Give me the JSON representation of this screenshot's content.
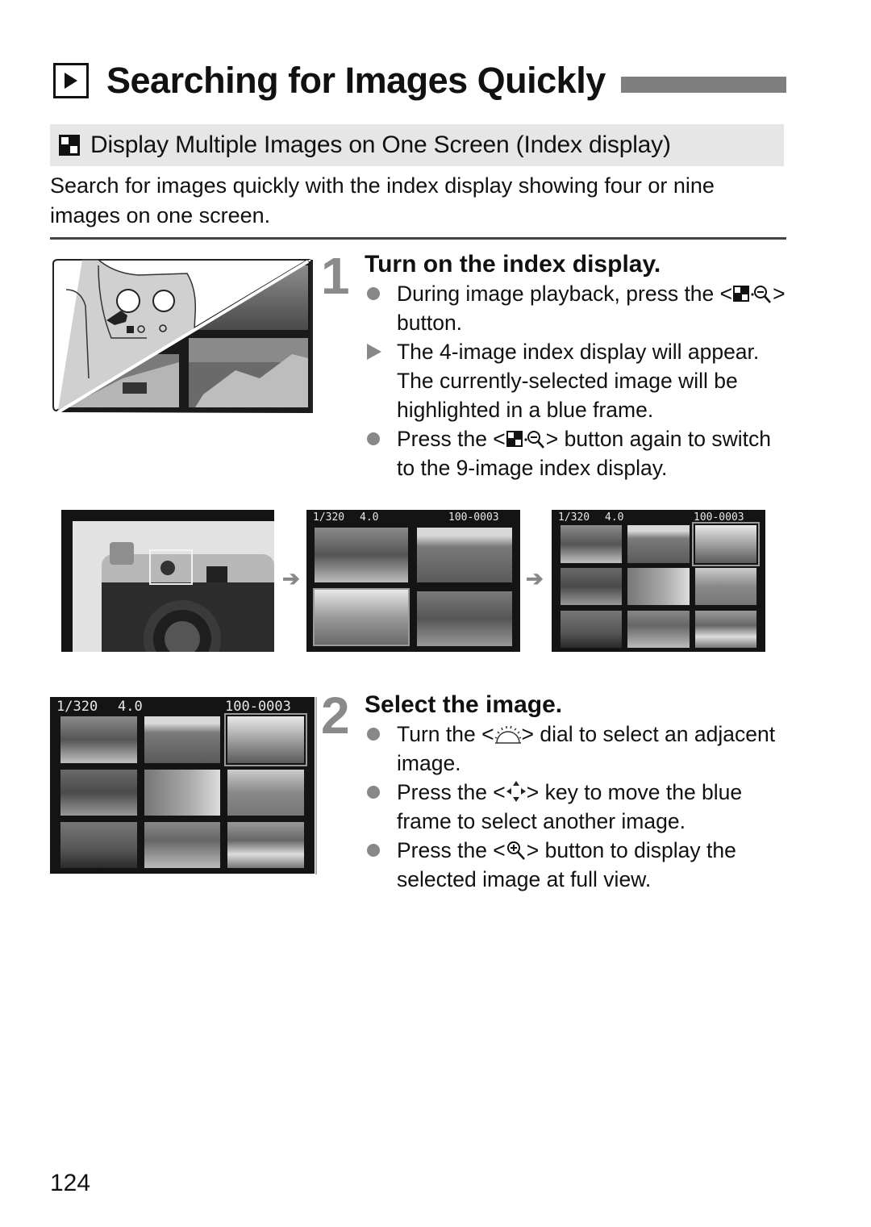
{
  "page": {
    "title": "Searching for Images Quickly",
    "title_icon": "playback-icon",
    "page_number": "124"
  },
  "section": {
    "title": "Display Multiple Images on One Screen (Index display)",
    "icon": "index-display-icon",
    "intro": "Search for images quickly with the index display showing four or nine images on one screen."
  },
  "steps": [
    {
      "number": "1",
      "title": "Turn on the index display.",
      "items": [
        {
          "marker": "bullet",
          "before": "During image playback, press the <",
          "icon": "index-reduce-button-icon",
          "after": "> button."
        },
        {
          "marker": "result",
          "before": "The 4-image index display will appear. The currently-selected image will be highlighted in a blue frame.",
          "icon": "",
          "after": ""
        },
        {
          "marker": "bullet",
          "before": "Press the <",
          "icon": "index-reduce-button-icon",
          "after": "> button again to switch to the 9-image index display."
        }
      ]
    },
    {
      "number": "2",
      "title": "Select the image.",
      "items": [
        {
          "marker": "bullet",
          "before": "Turn the <",
          "icon": "main-dial-icon",
          "after": "> dial to select an adjacent image."
        },
        {
          "marker": "bullet",
          "before": "Press the <",
          "icon": "cross-keys-icon",
          "after": "> key to move the blue frame to select another image."
        },
        {
          "marker": "bullet",
          "before": "Press the <",
          "icon": "magnify-button-icon",
          "after": "> button to display the selected image at full view."
        }
      ]
    }
  ],
  "screens": {
    "osd": {
      "shutter": "1/320",
      "aperture": "4.0",
      "file": "100-0003"
    },
    "four_index": {
      "count": 4,
      "selected_index": 2
    },
    "nine_index": {
      "count": 9,
      "selected_index": 2
    }
  },
  "colors": {
    "accent_gray": "#8a8a8a",
    "title_bar": "#7f7f7f",
    "section_bg": "#e6e6e6"
  }
}
